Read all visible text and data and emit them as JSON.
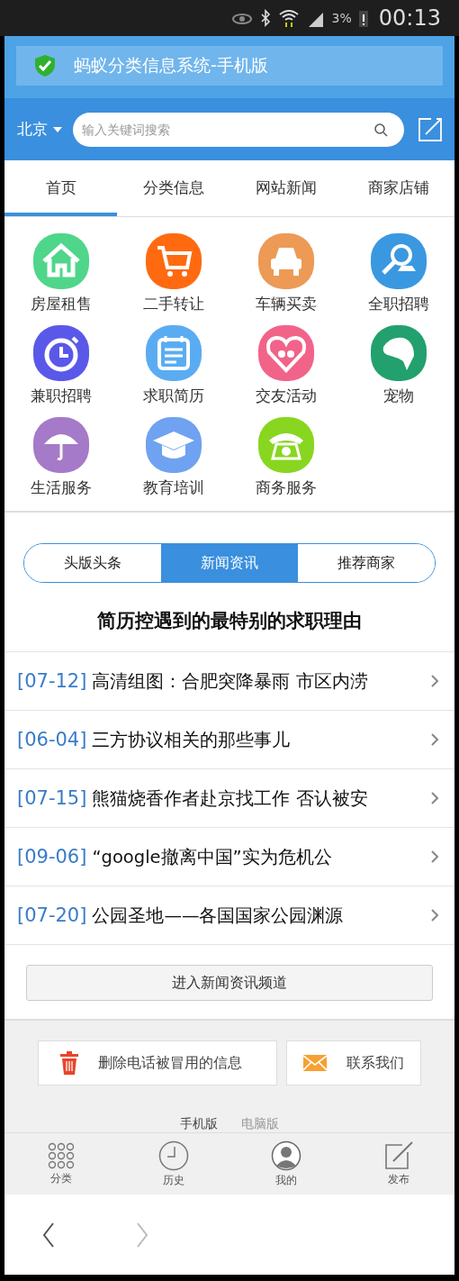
{
  "status_bar": {
    "battery": "3%",
    "time": "00:13"
  },
  "banner": {
    "title": "蚂蚁分类信息系统-手机版"
  },
  "header": {
    "city": "北京",
    "search": {
      "placeholder": "输入关键词搜索"
    }
  },
  "tabs": [
    {
      "label": "首页",
      "selected": true
    },
    {
      "label": "分类信息",
      "selected": false
    },
    {
      "label": "网站新闻",
      "selected": false
    },
    {
      "label": "商家店铺",
      "selected": false
    }
  ],
  "categories": [
    {
      "label": "房屋租售",
      "color": "#4fd68a"
    },
    {
      "label": "二手转让",
      "color": "#ff6a10"
    },
    {
      "label": "车辆买卖",
      "color": "#ec9a55"
    },
    {
      "label": "全职招聘",
      "color": "#3a98e0"
    },
    {
      "label": "兼职招聘",
      "color": "#5a58e8"
    },
    {
      "label": "求职简历",
      "color": "#5aacf2"
    },
    {
      "label": "交友活动",
      "color": "#f2638a"
    },
    {
      "label": "宠物",
      "color": "#22a06e"
    },
    {
      "label": "生活服务",
      "color": "#a57ac8"
    },
    {
      "label": "教育培训",
      "color": "#6fa2f0"
    },
    {
      "label": "商务服务",
      "color": "#88d620"
    }
  ],
  "news_tabs": [
    {
      "label": "头版头条",
      "selected": false
    },
    {
      "label": "新闻资讯",
      "selected": true
    },
    {
      "label": "推荐商家",
      "selected": false
    }
  ],
  "headline": "简历控遇到的最特别的求职理由",
  "news": [
    {
      "date": "[07-12]",
      "title": "高清组图：合肥突降暴雨 市区内涝"
    },
    {
      "date": "[06-04]",
      "title": "三方协议相关的那些事儿"
    },
    {
      "date": "[07-15]",
      "title": "熊猫烧香作者赴京找工作 否认被安"
    },
    {
      "date": "[09-06]",
      "title": "“google撤离中国”实为危机公"
    },
    {
      "date": "[07-20]",
      "title": "公园圣地——各国国家公园渊源"
    }
  ],
  "more_button": "进入新闻资讯频道",
  "footer": {
    "buttons": [
      "删除电话被冒用的信息",
      "联系我们"
    ],
    "versions": [
      {
        "label": "手机版",
        "selected": true
      },
      {
        "label": "电脑版",
        "selected": false
      }
    ]
  },
  "bottom_nav": [
    "分类",
    "历史",
    "我的",
    "发布"
  ]
}
